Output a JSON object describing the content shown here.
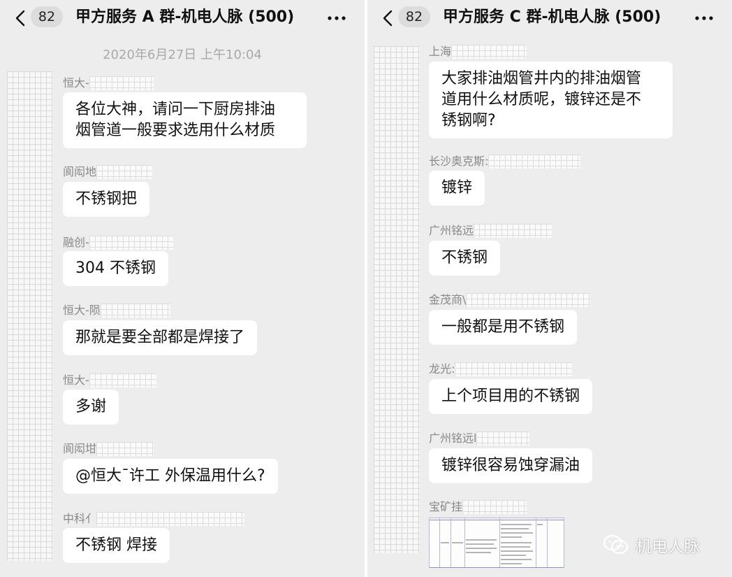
{
  "left": {
    "badge": "82",
    "title": "甲方服务 A 群-机电人脉 (500)",
    "timestamp": "2020年6月27日 上午10:04",
    "messages": [
      {
        "name": "恒大-",
        "text": "各位大神，请问一下厨房排油\n烟管道一般要求选用什么材质"
      },
      {
        "name": "阆闳地",
        "text": "不锈钢把"
      },
      {
        "name": "融创-",
        "text": "304 不锈钢"
      },
      {
        "name": "恒大-陨",
        "text": "那就是要全部都是焊接了"
      },
      {
        "name": "恒大-",
        "text": "多谢"
      },
      {
        "name": "阆闳坩",
        "text": "@恒大¯许工 外保温用什么?"
      },
      {
        "name": "中科亻",
        "text": "不锈钢 焊接"
      }
    ]
  },
  "right": {
    "badge": "82",
    "title": "甲方服务 C 群-机电人脉 (500)",
    "messages": [
      {
        "name": "上海",
        "text": "大家排油烟管井内的排油烟管\n道用什么材质呢，镀锌还是不\n锈钢啊?"
      },
      {
        "name": "长沙奥克斯:",
        "text": "镀锌"
      },
      {
        "name": "广州铭远",
        "text": "不锈钢"
      },
      {
        "name": "金茂商\\",
        "text": "一般都是用不锈钢"
      },
      {
        "name": "龙光:",
        "text": "上个项目用的不锈钢"
      },
      {
        "name": "广州铭远l",
        "text": "镀锌很容易蚀穿漏油"
      },
      {
        "name": "宝矿挂",
        "text": ""
      }
    ]
  },
  "watermark": {
    "text": "机电人脉",
    "icon": "wechat-icon"
  },
  "icons": {
    "back": "chevron-left-icon",
    "more": "more-dots-icon"
  },
  "colors": {
    "background": "#ededed",
    "bubble": "#ffffff",
    "timestamp": "#a9a9a9"
  }
}
